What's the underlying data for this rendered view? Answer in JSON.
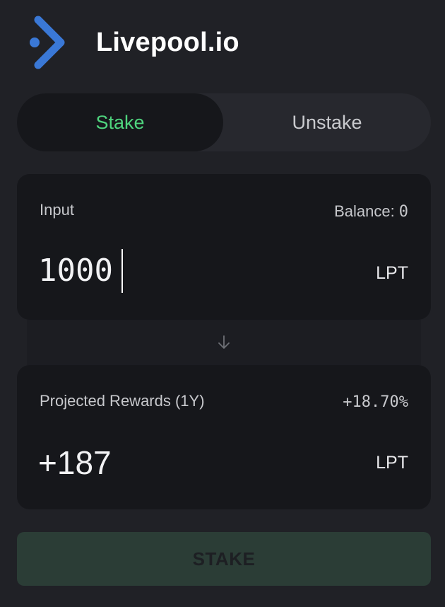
{
  "app": {
    "brand": "Livepool.io",
    "logo_icon": "livepool-logo-icon"
  },
  "tabs": [
    {
      "label": "Stake",
      "active": true
    },
    {
      "label": "Unstake",
      "active": false
    }
  ],
  "input_card": {
    "label": "Input",
    "balance_label": "Balance:",
    "balance_value": "0",
    "amount": "1000",
    "unit": "LPT"
  },
  "connector": {
    "icon": "arrow-down-icon"
  },
  "rewards_card": {
    "label": "Projected Rewards (1Y)",
    "rate": "+18.70%",
    "amount": "+187",
    "unit": "LPT"
  },
  "actions": {
    "stake_label": "STAKE",
    "stake_enabled": false
  },
  "colors": {
    "background": "#202126",
    "card": "#16171b",
    "active_tab_text": "#4fd47e",
    "logo_blue": "#3a78d6",
    "button_disabled": "#2b3d36"
  }
}
